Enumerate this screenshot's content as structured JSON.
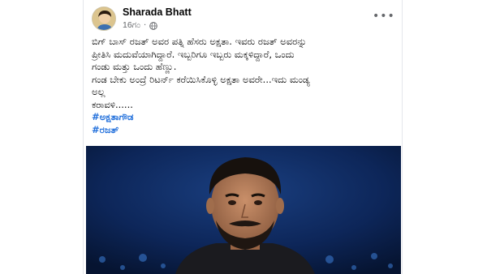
{
  "post": {
    "author": "Sharada Bhatt",
    "timestamp": "16ಗಂ",
    "more_label": "•••",
    "text_lines": [
      "ಬಿಗ್ ಬಾಸ್ ರಜತ್ ಅವರ ಪತ್ನಿ ಹೆಸರು ಅಕ್ಷತಾ. ಇವರು ರಜತ್ ಅವರನ್ನು",
      "ಪ್ರೀತಿಸಿ ಮದುವೆಯಾಗಿದ್ದಾರೆ. ಇಬ್ಬರಿಗೂ ಇಬ್ಬರು ಮಕ್ಕಳಿದ್ದಾರೆ, ಒಂದು",
      "ಗಂಡು ಮತ್ತು ಒಂದು ಹೆಣ್ಣು.",
      "ಗಂಡ ಬೇಕು ಅಂದ್ರೆ ರಿಟರ್ನ್ ಕರೆಯಿಸಿಕೊಳ್ಳಿ ಅಕ್ಷತಾ ಅವರೇ...ಇದು ಮಂಡ್ಯ",
      "ಅಲ್ಲ",
      "ಕರಾವಳಿ......"
    ],
    "hashtags": [
      "#ಅಕ್ಷತಾಗೌಡ",
      "#ರಜತ್"
    ]
  },
  "icons": {
    "avatar": "profile-avatar",
    "globe": "globe-icon",
    "more": "more-options-icon"
  },
  "colors": {
    "hashtag": "#216fdb",
    "meta": "#65676b",
    "image_background": "#0a1d44"
  }
}
